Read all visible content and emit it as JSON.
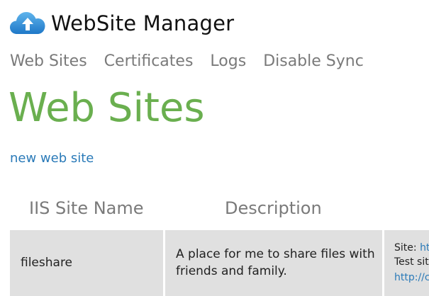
{
  "app": {
    "title": "WebSite Manager",
    "logo_icon": "cloud-upload-icon",
    "accent_color": "#2a7ab8",
    "title_color": "#6aaf4f"
  },
  "nav": {
    "items": [
      {
        "label": "Web Sites"
      },
      {
        "label": "Certificates"
      },
      {
        "label": "Logs"
      },
      {
        "label": "Disable Sync"
      }
    ]
  },
  "main": {
    "title": "Web Sites",
    "new_link": "new web site",
    "columns": [
      "IIS Site Name",
      "Description"
    ],
    "rows": [
      {
        "name": "fileshare",
        "description": "A place for me to share files with friends and family.",
        "site_label": "Site:",
        "site_link": "ht",
        "test_label": "Test sit",
        "test_link": "http://c"
      }
    ]
  }
}
